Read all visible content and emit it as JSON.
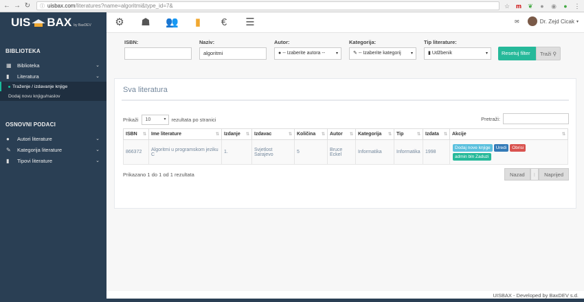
{
  "browser": {
    "url_host": "uisbax.com",
    "url_path": "/literatures?name=algoritmi&type_id=7&"
  },
  "logo": {
    "text_left": "UIS",
    "text_right": "BAX",
    "by": "by BaxDEV"
  },
  "user": {
    "name": "Dr. Zejd Cicak"
  },
  "sidebar": {
    "section1": "BIBLIOTEKA",
    "items1": [
      {
        "label": "Biblioteka"
      },
      {
        "label": "Literatura"
      }
    ],
    "subitems": [
      {
        "label": "Traženje / izdavanje knjige"
      },
      {
        "label": "Dodaj novu knjigu/naslov"
      }
    ],
    "section2": "OSNOVNI PODACI",
    "items2": [
      {
        "label": "Autori literature"
      },
      {
        "label": "Kategorija literature"
      },
      {
        "label": "Tipovi literature"
      }
    ]
  },
  "filters": {
    "isbn_label": "ISBN:",
    "isbn_value": "",
    "naziv_label": "Naziv:",
    "naziv_value": "algoritmi",
    "autor_label": "Autor:",
    "autor_value": "-- Izaberite autora --",
    "kategorija_label": "Kategorija:",
    "kategorija_value": "-- Izaberite kategorij",
    "tip_label": "Tip literature:",
    "tip_value": "Udžbenik",
    "reset_label": "Resetuj filter Z",
    "search_label": "Traži"
  },
  "panel": {
    "title": "Sva literatura",
    "show_prefix": "Prikaži",
    "show_value": "10",
    "show_suffix": "rezultata po stranici",
    "search_label": "Pretraži:",
    "columns": [
      "ISBN",
      "Ime literature",
      "Izdanje",
      "Izdavac",
      "Količina",
      "Autor",
      "Kategorija",
      "Tip",
      "Izdata",
      "Akcije"
    ],
    "rows": [
      {
        "isbn": "866372",
        "name": "Algoritmi u programskom jeziku C",
        "izdanje": "1.",
        "izdavac": "Svjetlost Sarajevo",
        "kolicina": "5",
        "autor": "Bruce Eckel",
        "kategorija": "Informatika",
        "tip": "Informatika",
        "izdata": "1998",
        "actions": [
          "Dodaj nove knjige",
          "Uredi",
          "Obrisi",
          "admin bln Zaduzi"
        ]
      }
    ],
    "info": "Prikazano 1 do 1 od 1 rezultata",
    "prev": "Nazad",
    "next": "Naprijed"
  },
  "footer": "UISBAX - Developed by BaxDEV s.d."
}
